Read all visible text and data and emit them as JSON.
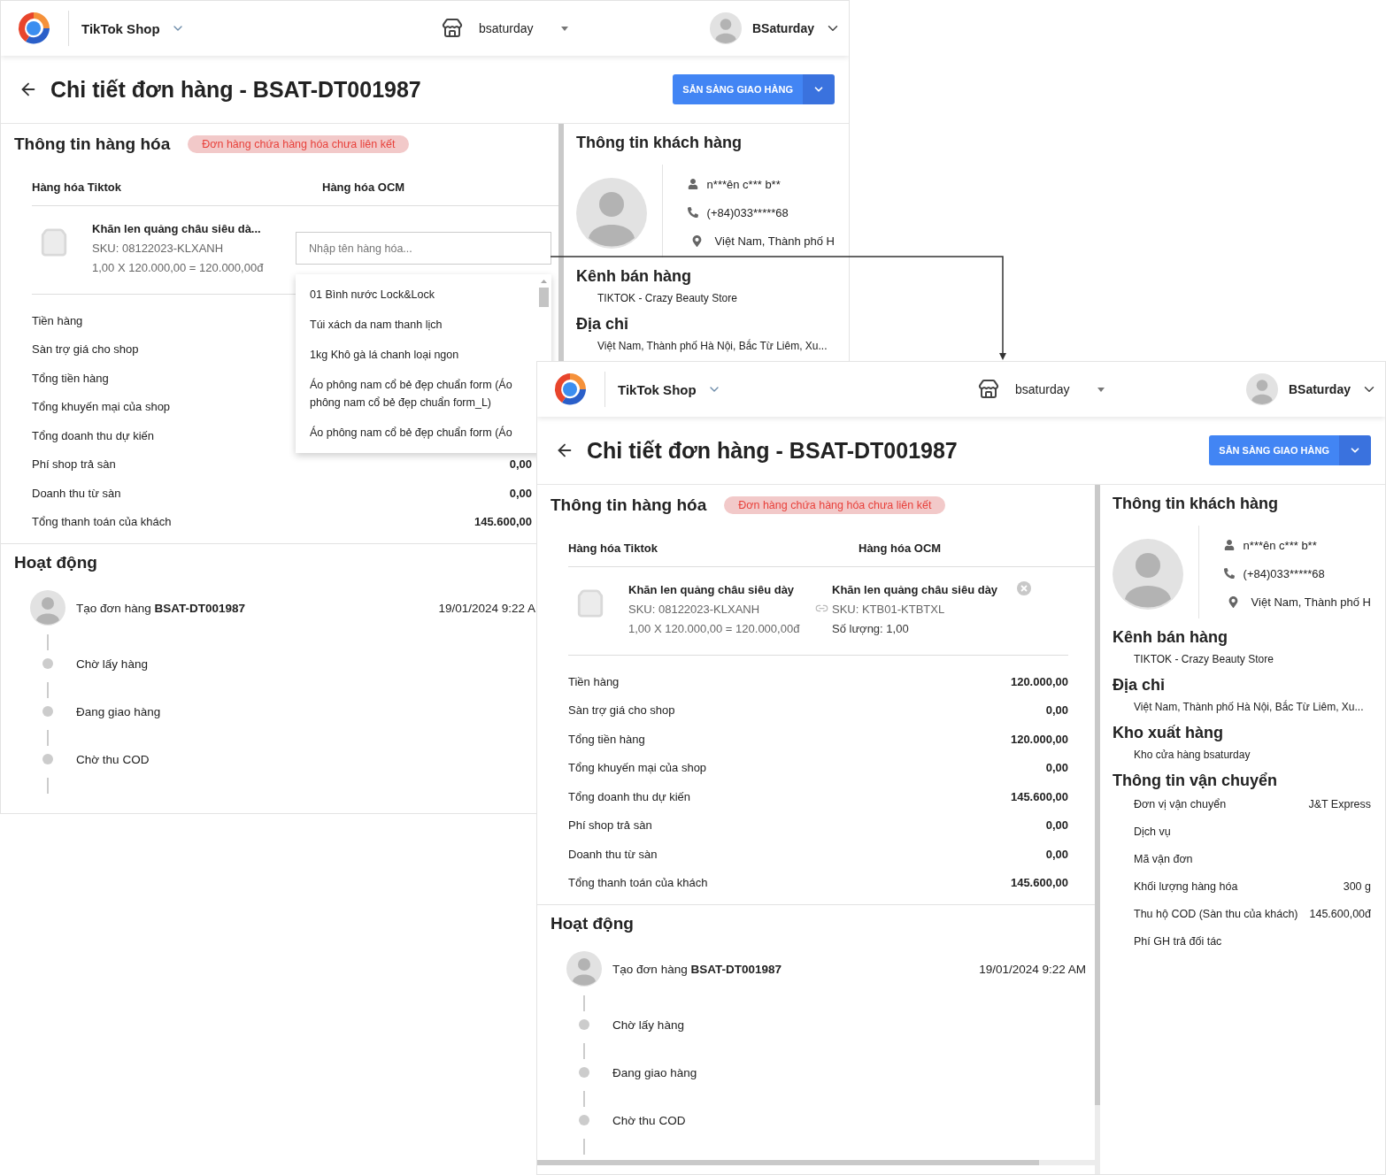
{
  "screens": [
    {
      "header": {
        "app": "TikTok Shop",
        "store": "bsaturday",
        "user": "BSaturday"
      },
      "title": "Chi tiết đơn hàng - BSAT-DT001987",
      "action_button": "SẴN SÀNG GIAO HÀNG",
      "goods": {
        "title": "Thông tin hàng hóa",
        "badge": "Đơn hàng chứa hàng hóa chưa liên kết",
        "columns": [
          "Hàng hóa Tiktok",
          "Hàng hóa OCM"
        ],
        "item": {
          "name": "Khăn len quảng châu siêu dà...",
          "sku": "SKU: 08122023-KLXANH",
          "price_line": "1,00 X 120.000,00 = 120.000,00đ"
        },
        "match": {
          "kind": "search",
          "placeholder": "Nhập tên hàng hóa...",
          "options": [
            "01 Bình nước Lock&Lock",
            "Túi xách da nam thanh lịch",
            "1kg Khô gà lá chanh loại ngon",
            "Áo phông nam cổ bẻ đẹp chuẩn form (Áo phông nam cổ bẻ đẹp chuẩn form_L)",
            "Áo phông nam cổ bẻ đẹp chuẩn form (Áo"
          ]
        }
      },
      "summary": [
        {
          "label": "Tiền hàng"
        },
        {
          "label": "Sàn trợ giá cho shop"
        },
        {
          "label": "Tổng tiền hàng"
        },
        {
          "label": "Tổng khuyến mại của shop"
        },
        {
          "label": "Tổng doanh thu dự kiến"
        },
        {
          "label": "Phí shop trả sàn",
          "value": "0,00"
        },
        {
          "label": "Doanh thu từ sàn",
          "value": "0,00"
        },
        {
          "label": "Tổng thanh toán của khách",
          "value": "145.600,00"
        }
      ],
      "activity": {
        "title": "Hoạt động",
        "events": [
          {
            "kind": "created",
            "text": "Tạo đơn hàng **BSAT-DT001987**",
            "time": "19/01/2024 9:22 A"
          },
          {
            "kind": "step",
            "text": "Chờ lấy hàng"
          },
          {
            "kind": "step",
            "text": "Đang giao hàng"
          },
          {
            "kind": "step",
            "text": "Chờ thu COD"
          }
        ]
      },
      "customer": {
        "title": "Thông tin khách hàng",
        "name": "n***ên c*** b**",
        "phone": "(+84)033*****68",
        "address": "Việt Nam, Thành phố H"
      },
      "sections": [
        {
          "title": "Kênh bán hàng",
          "lines": [
            "TIKTOK - Crazy Beauty Store"
          ]
        },
        {
          "title": "Địa chỉ",
          "lines": [
            "Việt Nam, Thành phố Hà Nội, Bắc Từ Liêm, Xu..."
          ]
        }
      ]
    },
    {
      "header": {
        "app": "TikTok Shop",
        "store": "bsaturday",
        "user": "BSaturday"
      },
      "title": "Chi tiết đơn hàng - BSAT-DT001987",
      "action_button": "SẴN SÀNG GIAO HÀNG",
      "goods": {
        "title": "Thông tin hàng hóa",
        "badge": "Đơn hàng chứa hàng hóa chưa liên kết",
        "columns": [
          "Hàng hóa Tiktok",
          "Hàng hóa OCM"
        ],
        "item": {
          "name": "Khăn len quảng châu siêu dày",
          "sku": "SKU: 08122023-KLXANH",
          "price_line": "1,00 X 120.000,00 = 120.000,00đ"
        },
        "match": {
          "kind": "linked",
          "name": "Khăn len quảng châu siêu dày",
          "sku": "SKU: KTB01-KTBTXL",
          "quantity": "Số lượng: 1,00"
        }
      },
      "summary": [
        {
          "label": "Tiền hàng",
          "value": "120.000,00"
        },
        {
          "label": "Sàn trợ giá cho shop",
          "value": "0,00"
        },
        {
          "label": "Tổng tiền hàng",
          "value": "120.000,00"
        },
        {
          "label": "Tổng khuyến mại của shop",
          "value": "0,00"
        },
        {
          "label": "Tổng doanh thu dự kiến",
          "value": "145.600,00"
        },
        {
          "label": "Phí shop trả sàn",
          "value": "0,00"
        },
        {
          "label": "Doanh thu từ sàn",
          "value": "0,00"
        },
        {
          "label": "Tổng thanh toán của khách",
          "value": "145.600,00"
        }
      ],
      "activity": {
        "title": "Hoạt động",
        "events": [
          {
            "kind": "created",
            "text": "Tạo đơn hàng **BSAT-DT001987**",
            "time": "19/01/2024 9:22 AM"
          },
          {
            "kind": "step",
            "text": "Chờ lấy hàng"
          },
          {
            "kind": "step",
            "text": "Đang giao hàng"
          },
          {
            "kind": "step",
            "text": "Chờ thu COD"
          }
        ]
      },
      "customer": {
        "title": "Thông tin khách hàng",
        "name": "n***ên c*** b**",
        "phone": "(+84)033*****68",
        "address": "Việt Nam, Thành phố H"
      },
      "sections": [
        {
          "title": "Kênh bán hàng",
          "lines": [
            "TIKTOK - Crazy Beauty Store"
          ]
        },
        {
          "title": "Địa chỉ",
          "lines": [
            "Việt Nam, Thành phố Hà Nội, Bắc Từ Liêm, Xu..."
          ]
        },
        {
          "title": "Kho xuất hàng",
          "lines": [
            "Kho cửa hàng bsaturday"
          ]
        },
        {
          "title": "Thông tin vận chuyển",
          "rows": [
            {
              "label": "Đơn vị vận chuyển",
              "value": "J&T Express"
            },
            {
              "label": "Dịch vụ"
            },
            {
              "label": "Mã vận đơn"
            },
            {
              "label": "Khối lượng hàng hóa",
              "value": "300 g"
            },
            {
              "label": "Thu hộ COD (Sàn thu của khách)",
              "value": "145.600,00đ"
            },
            {
              "label": "Phí GH trả đối tác"
            }
          ]
        }
      ]
    }
  ]
}
